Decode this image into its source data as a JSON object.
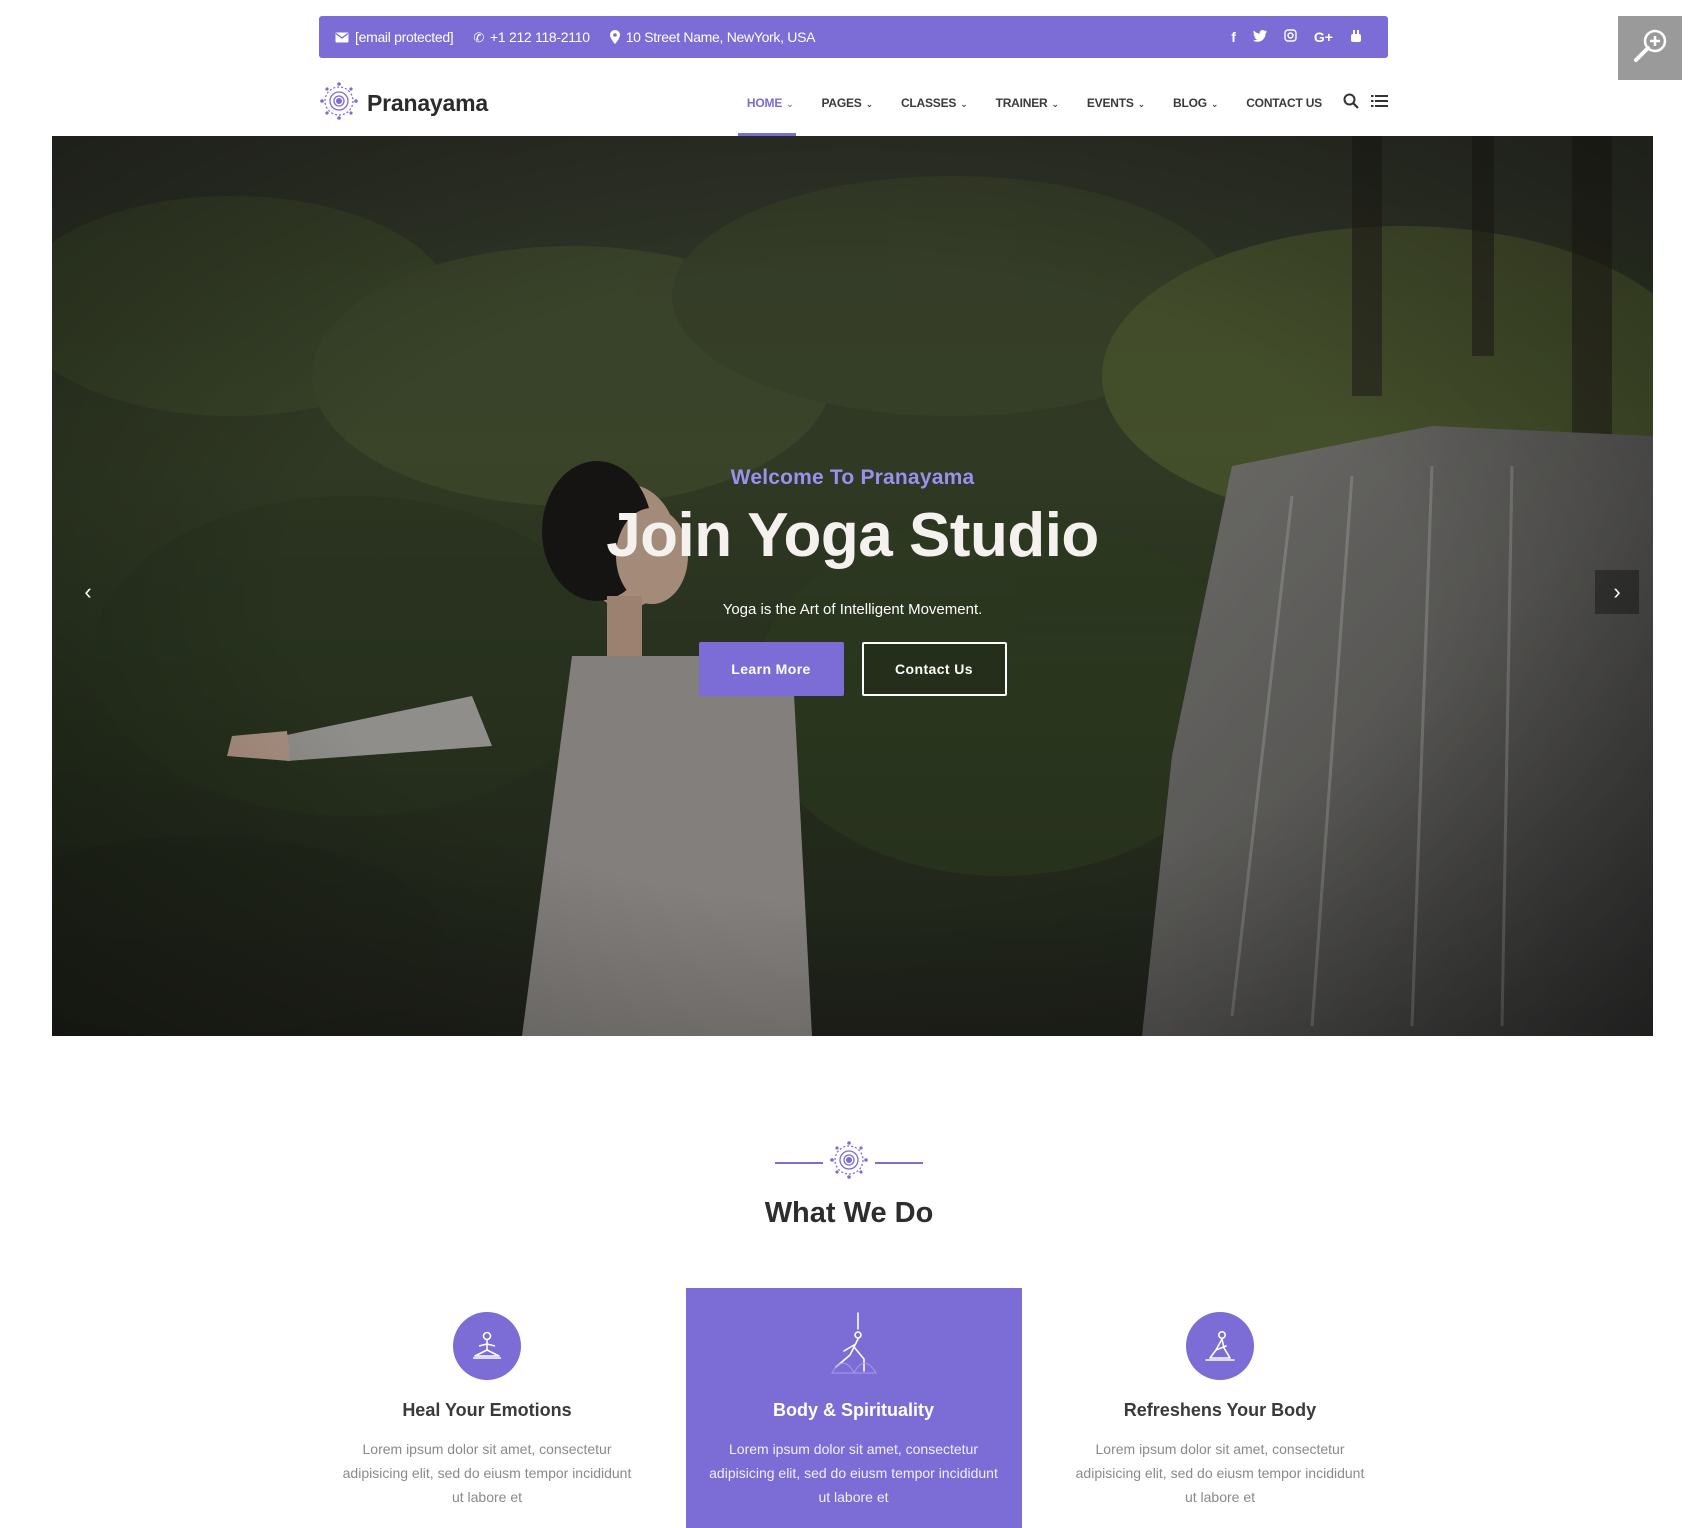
{
  "colors": {
    "accent": "#7b6cd6",
    "hero_kicker": "#9b8ff0"
  },
  "topbar": {
    "email": "[email protected]",
    "phone": "+1 212 118-2110",
    "address": "10 Street Name, NewYork, USA",
    "social": {
      "facebook": "f",
      "twitter": "t",
      "instagram": "◎",
      "google_plus": "G+",
      "youtube": "▶"
    }
  },
  "header": {
    "brand": "Pranayama",
    "nav": [
      {
        "label": "HOME",
        "has_dropdown": true,
        "active": true
      },
      {
        "label": "PAGES",
        "has_dropdown": true
      },
      {
        "label": "CLASSES",
        "has_dropdown": true
      },
      {
        "label": "TRAINER",
        "has_dropdown": true
      },
      {
        "label": "EVENTS",
        "has_dropdown": true
      },
      {
        "label": "BLOG",
        "has_dropdown": true
      },
      {
        "label": "CONTACT US",
        "has_dropdown": false
      }
    ],
    "tools": [
      "search-icon",
      "menu-icon"
    ]
  },
  "hero": {
    "kicker": "Welcome To Pranayama",
    "title": "Join Yoga Studio",
    "subtitle": "Yoga is the Art of Intelligent Movement.",
    "primary_button": "Learn More",
    "secondary_button": "Contact Us",
    "prev_arrow": "‹",
    "next_arrow": "›"
  },
  "what_we_do": {
    "title": "What We Do",
    "features": [
      {
        "title": "Heal Your Emotions",
        "text": "Lorem ipsum dolor sit amet, consectetur adipisicing elit, sed do eiusm tempor incididunt ut labore et",
        "icon": "meditation-icon",
        "highlight": false
      },
      {
        "title": "Body & Spirituality",
        "text": "Lorem ipsum dolor sit amet, consectetur adipisicing elit, sed do eiusm tempor incididunt ut labore et",
        "icon": "yoga-pose-icon",
        "highlight": true
      },
      {
        "title": "Refreshens Your Body",
        "text": "Lorem ipsum dolor sit amet, consectetur adipisicing elit, sed do eiusm tempor incididunt ut labore et",
        "icon": "stretch-pose-icon",
        "highlight": false
      }
    ]
  }
}
